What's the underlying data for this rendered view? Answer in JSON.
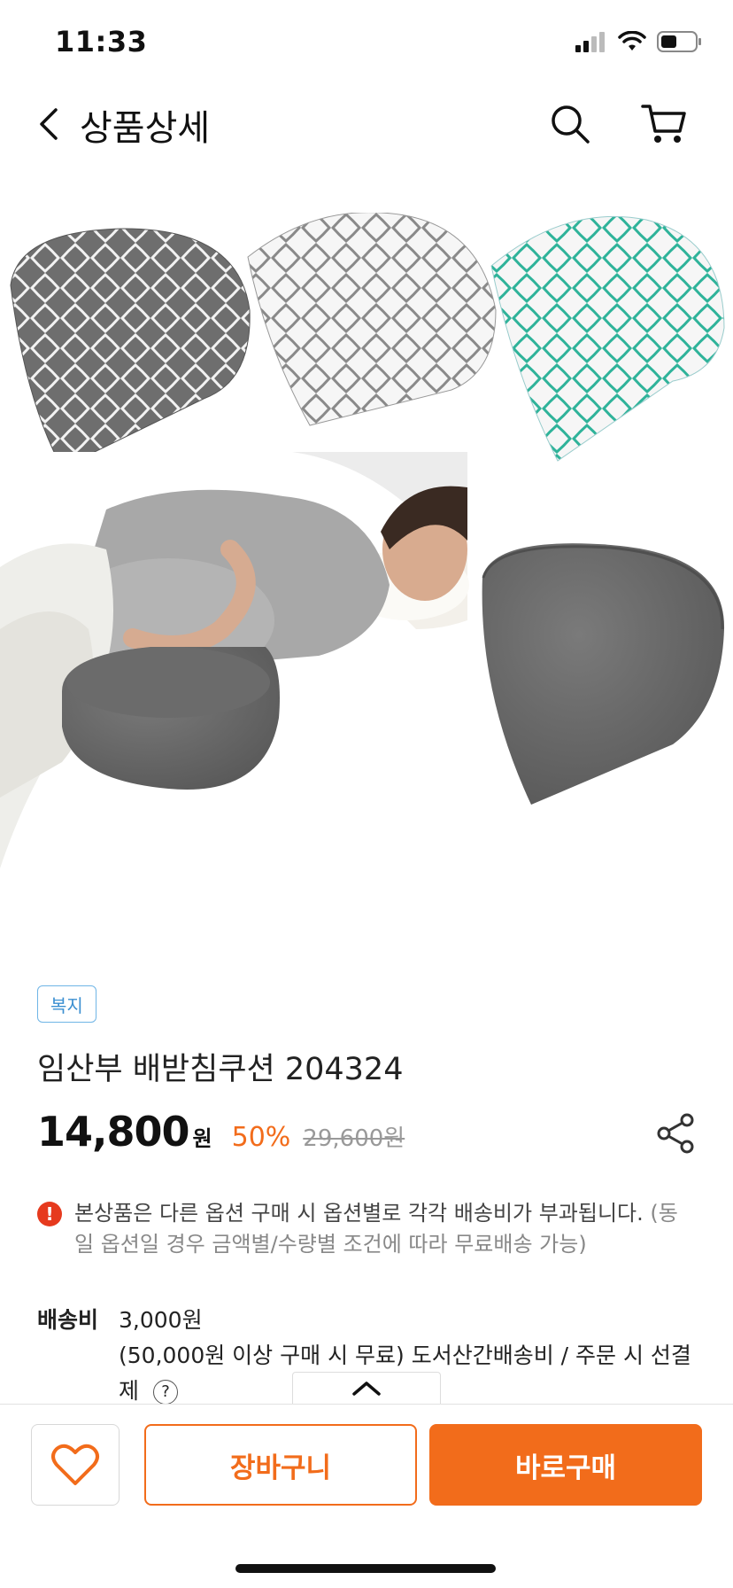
{
  "status_bar": {
    "time": "11:33"
  },
  "header": {
    "title": "상품상세"
  },
  "product": {
    "badge": "복지",
    "name": "임산부 배받침쿠션 204324",
    "price": "14,800",
    "price_unit": "원",
    "discount": "50%",
    "original_price": "29,600원"
  },
  "notice": {
    "main": "본상품은 다른 옵션 구매 시 옵션별로 각각 배송비가 부과됩니다.",
    "sub": "(동일 옵션일 경우 금액별/수량별 조건에 따라 무료배송 가능)"
  },
  "shipping": {
    "label": "배송비",
    "fee": "3,000원",
    "detail": "(50,000원 이상 구매 시 무료) 도서산간배송비 / 주문 시 선결제"
  },
  "bottom_bar": {
    "cart_label": "장바구니",
    "buy_label": "바로구매"
  },
  "colors": {
    "accent": "#f26c1b",
    "badge": "#3b8fd1",
    "alert": "#e63a1e"
  }
}
